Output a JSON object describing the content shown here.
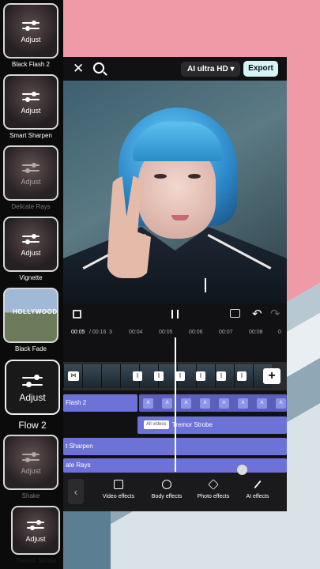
{
  "effects_panel": {
    "items": [
      {
        "thumb_label": "Adjust",
        "name": "Black Flash 2"
      },
      {
        "thumb_label": "Adjust",
        "name": "Smart Sharpen"
      },
      {
        "thumb_label": "Adjust",
        "name": "Delicate Rays"
      },
      {
        "thumb_label": "Adjust",
        "name": "Vignette"
      },
      {
        "thumb_label": "",
        "name": "Black Fade"
      },
      {
        "thumb_label": "Adjust",
        "name": "Flow 2"
      },
      {
        "thumb_label": "Adjust",
        "name": "Shake"
      },
      {
        "thumb_label": "Adjust",
        "name": "Tremor Strobe"
      }
    ],
    "sign_text": "HOLLYWOOD"
  },
  "toolbar": {
    "quality_label": "AI ultra HD",
    "export_label": "Export"
  },
  "timeline": {
    "current_time": "00:05",
    "total_time": "/ 00:16",
    "ticks": [
      "3",
      "00:04",
      "00:05",
      "00:06",
      "00:07",
      "00:08",
      "0"
    ],
    "tracks": {
      "flash": "Flash 2",
      "strobe_badge": "All videos",
      "strobe": "Tremor Strobe",
      "sharpen": "t Sharpen",
      "rays": "ate Rays"
    },
    "chip_label": "A"
  },
  "bottom_tools": [
    {
      "label": "Video effects",
      "icon": "video-effects-icon"
    },
    {
      "label": "Body effects",
      "icon": "body-effects-icon"
    },
    {
      "label": "Photo effects",
      "icon": "photo-effects-icon"
    },
    {
      "label": "AI effects",
      "icon": "ai-effects-icon"
    }
  ],
  "colors": {
    "accent_track": "#6d73d6",
    "export_bg": "#d3f3f5",
    "background_pink": "#ef9aa6"
  }
}
